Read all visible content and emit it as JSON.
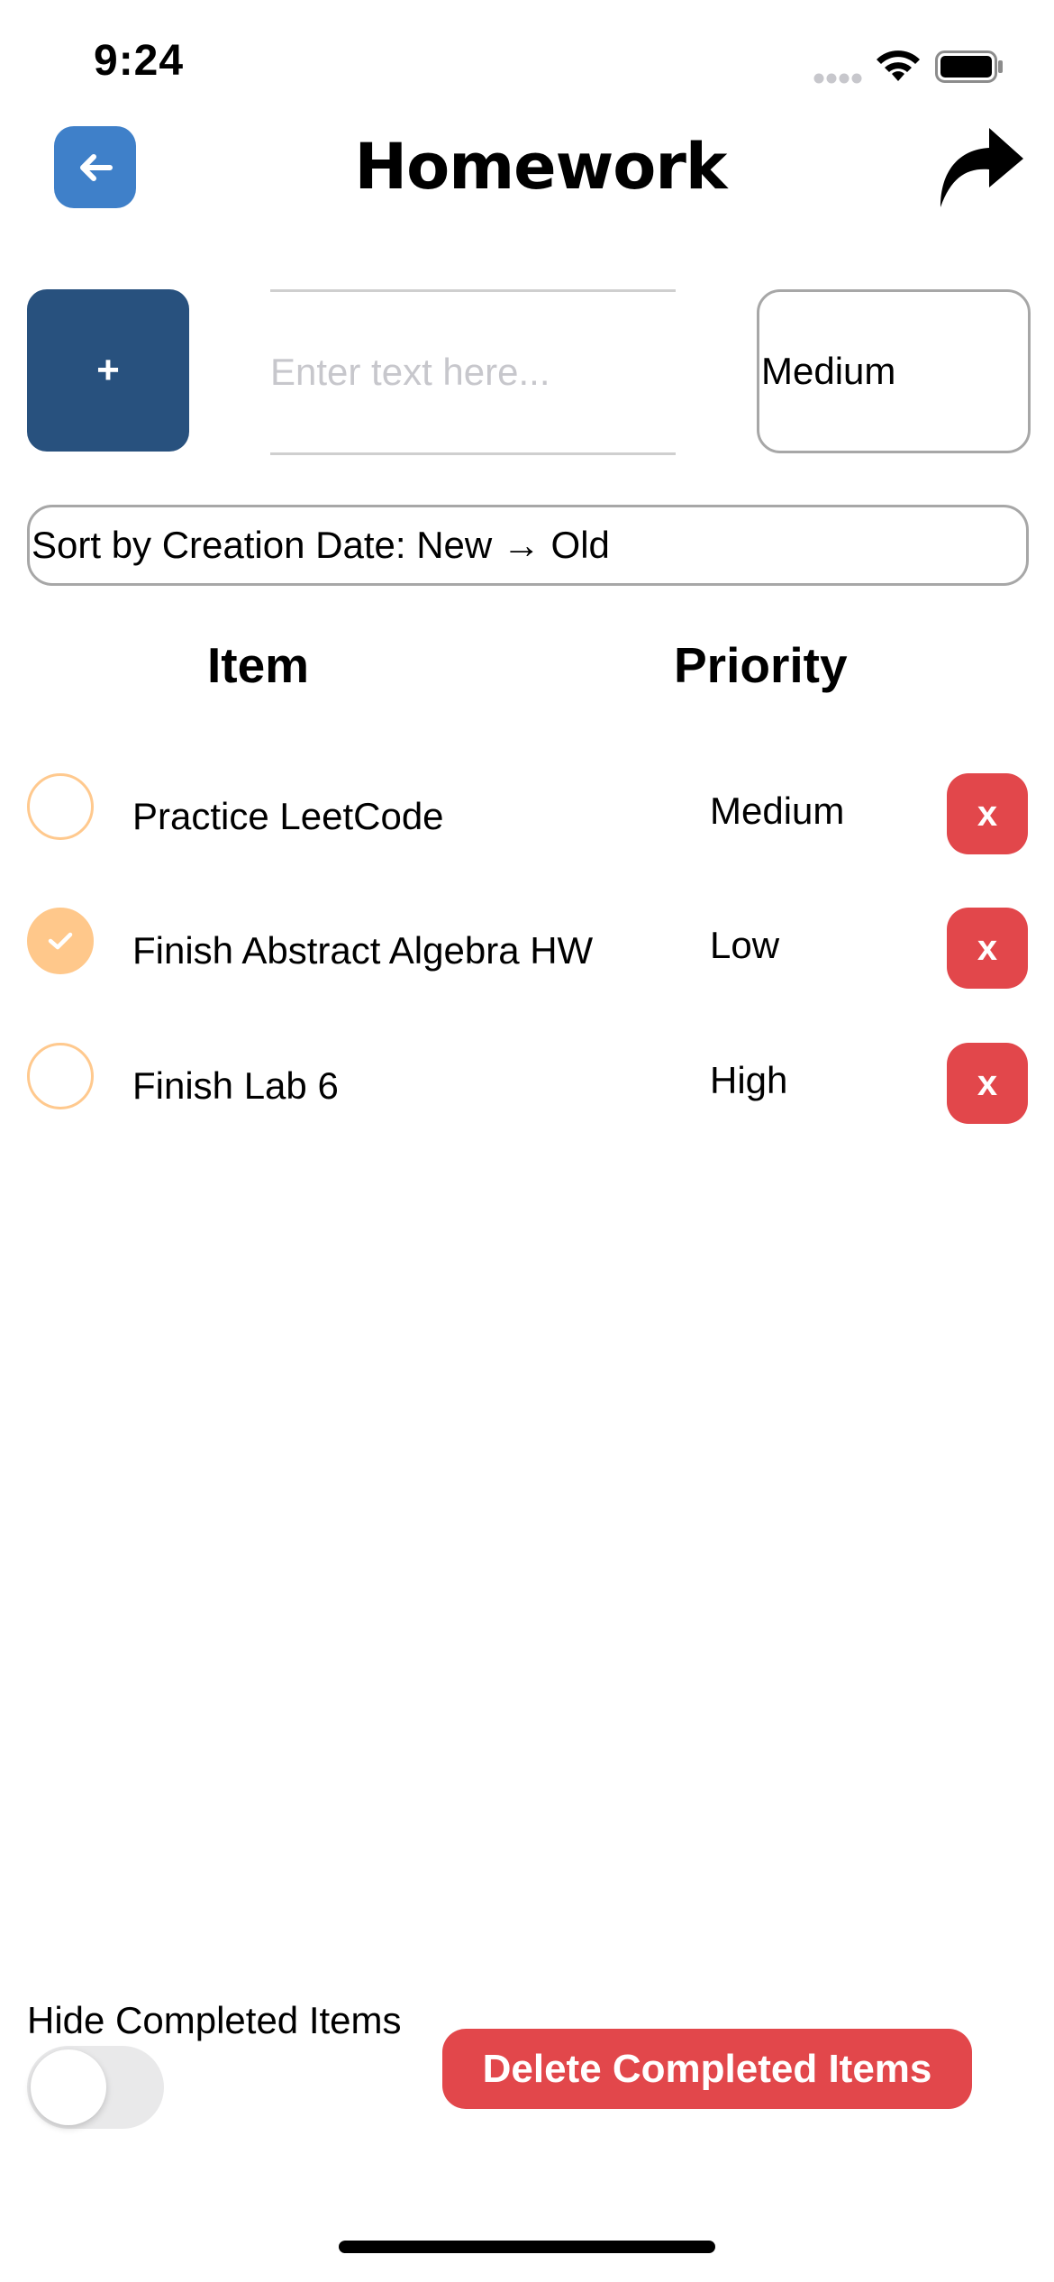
{
  "status_bar": {
    "time": "9:24"
  },
  "header": {
    "title": "Homework",
    "back_icon": "arrow-left-icon",
    "share_icon": "share-arrow-icon"
  },
  "add_row": {
    "add_label": "+",
    "input_value": "",
    "input_placeholder": "Enter text here...",
    "priority_selected": "Medium"
  },
  "sort": {
    "selected": "Sort by Creation Date: New → Old"
  },
  "columns": {
    "item": "Item",
    "priority": "Priority"
  },
  "items": [
    {
      "title": "Practice LeetCode",
      "priority": "Medium",
      "completed": false,
      "delete_label": "x"
    },
    {
      "title": "Finish Abstract Algebra HW",
      "priority": "Low",
      "completed": true,
      "delete_label": "x"
    },
    {
      "title": "Finish Lab 6",
      "priority": "High",
      "completed": false,
      "delete_label": "x"
    }
  ],
  "footer": {
    "hide_completed_label": "Hide Completed Items",
    "hide_completed_on": false,
    "delete_completed_label": "Delete Completed Items"
  },
  "colors": {
    "back_button": "#3f80c9",
    "add_button": "#28517e",
    "delete_red": "#e2474b",
    "check_orange": "#ffc88b"
  }
}
